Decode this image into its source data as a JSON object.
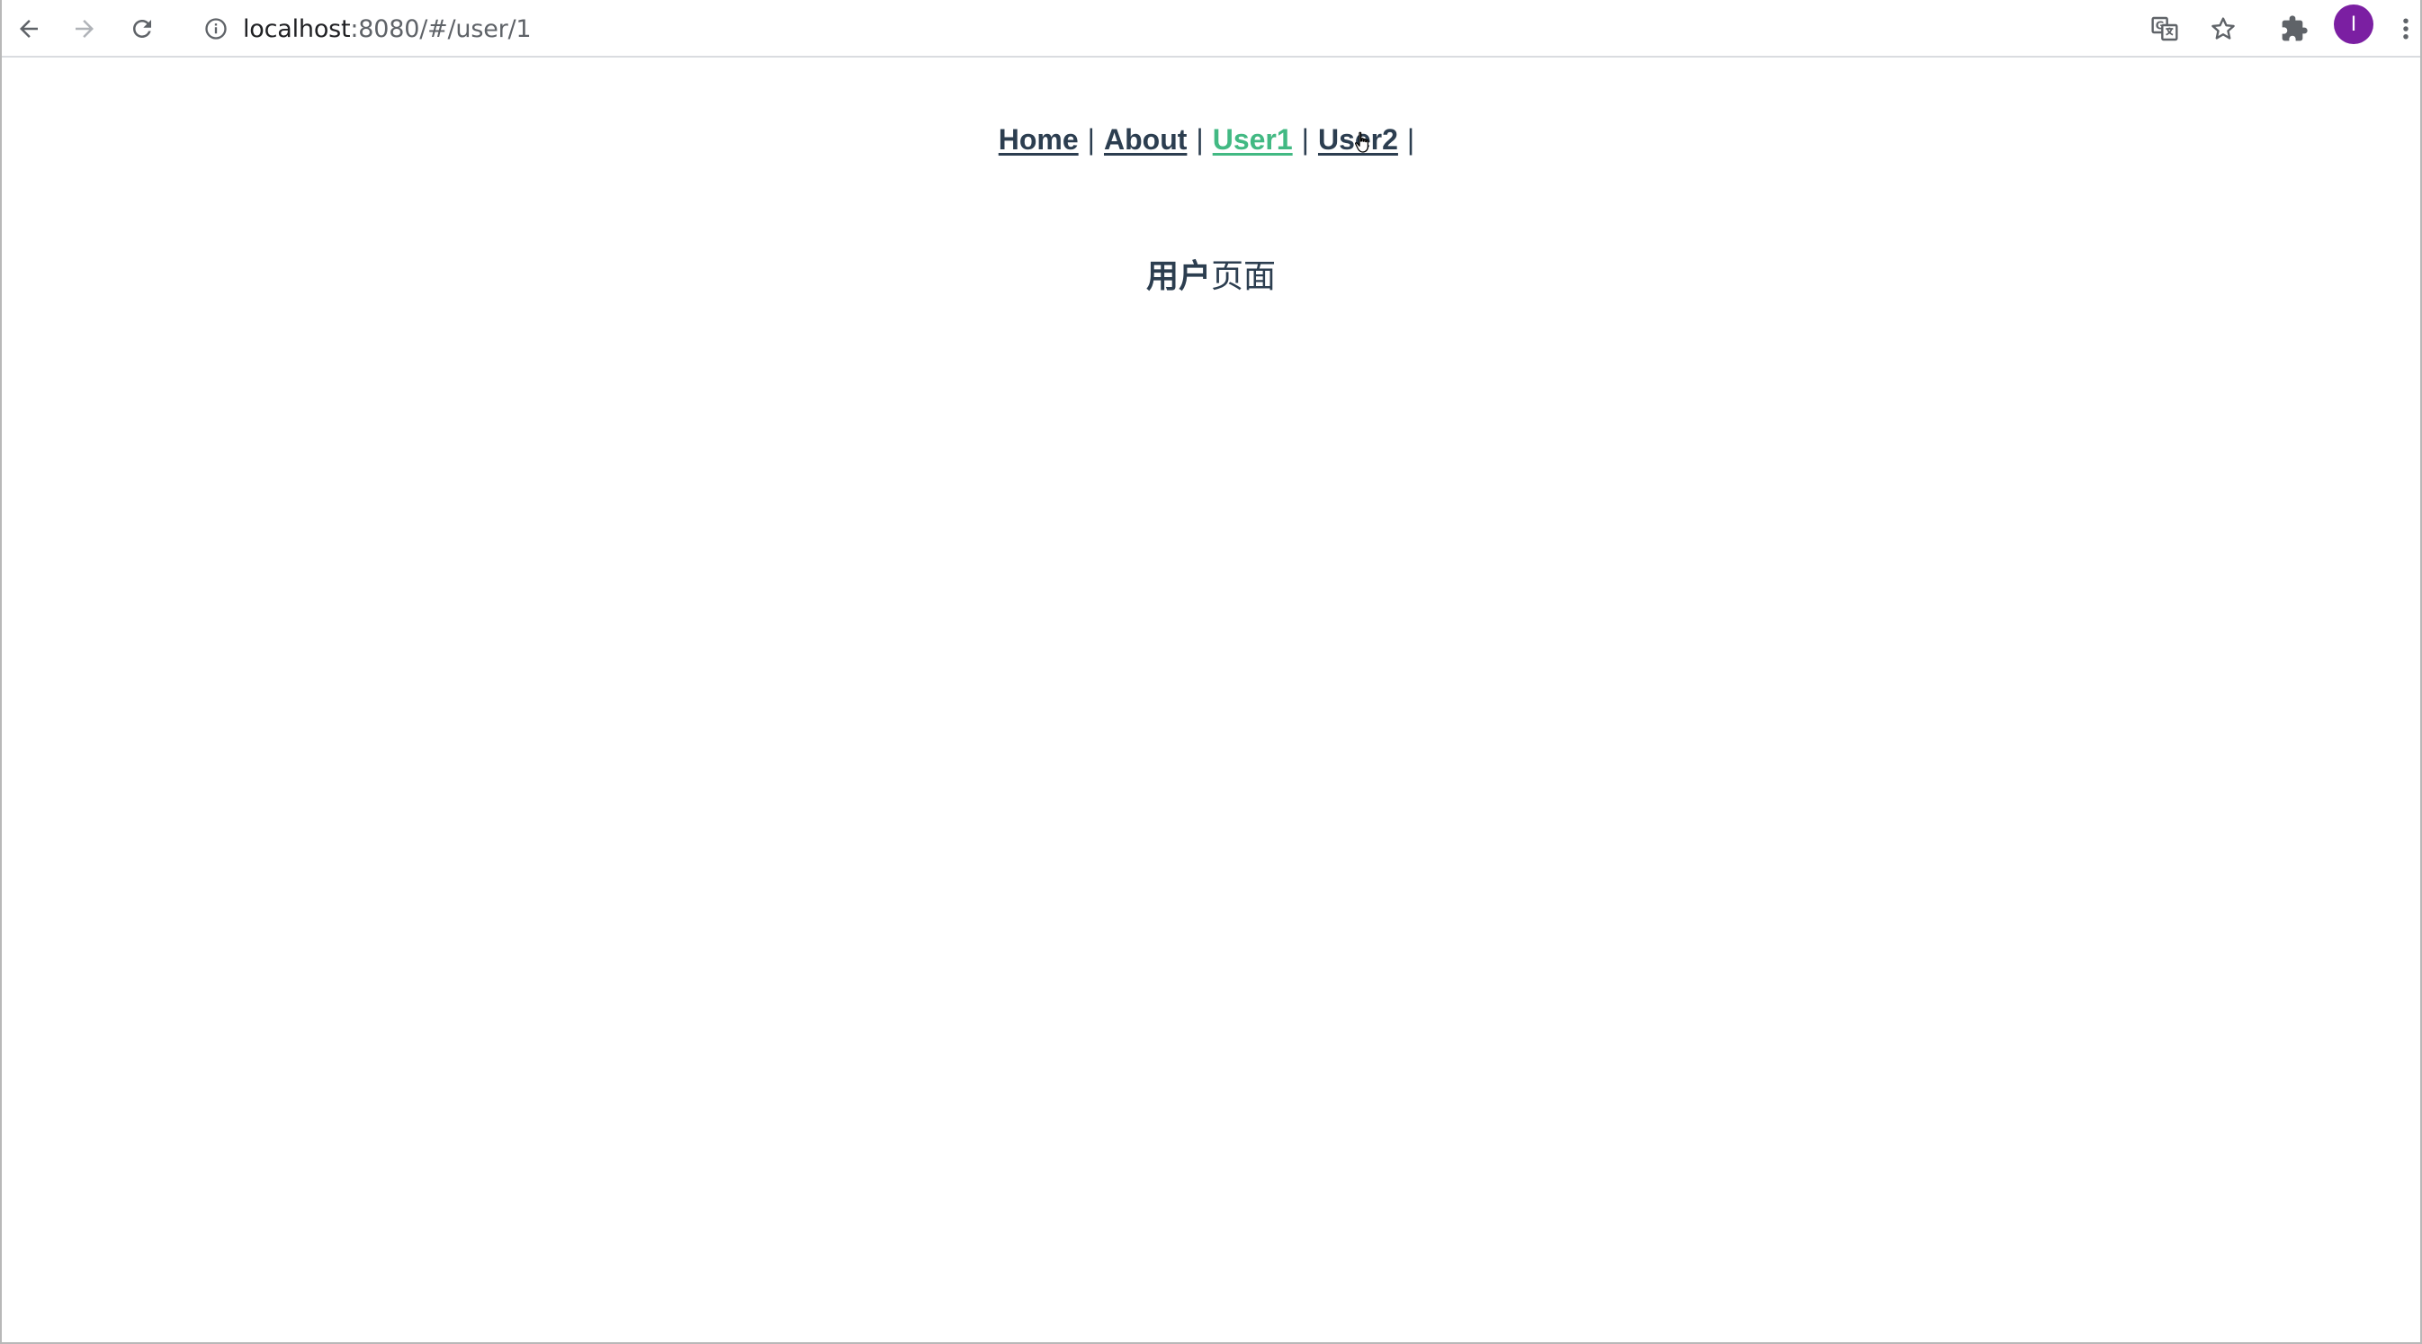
{
  "browser": {
    "url_host": "localhost",
    "url_rest": ":8080/#/user/1",
    "profile_initial": "I",
    "icons": {
      "back": "arrow-left-icon",
      "forward": "arrow-right-icon",
      "reload": "reload-icon",
      "info": "info-icon",
      "translate": "translate-icon",
      "bookmark": "star-icon",
      "extensions": "puzzle-icon",
      "menu": "kebab-menu-icon"
    },
    "colors": {
      "avatar": "#7b1fa2"
    }
  },
  "nav": {
    "items": [
      {
        "label": "Home",
        "active": false
      },
      {
        "label": "About",
        "active": false
      },
      {
        "label": "User1",
        "active": true
      },
      {
        "label": "User2",
        "active": false
      }
    ],
    "separator": "|"
  },
  "content": {
    "heading_bold": "用户",
    "heading_normal": "页面"
  },
  "colors": {
    "text": "#2c3e50",
    "active_link": "#42b983"
  }
}
